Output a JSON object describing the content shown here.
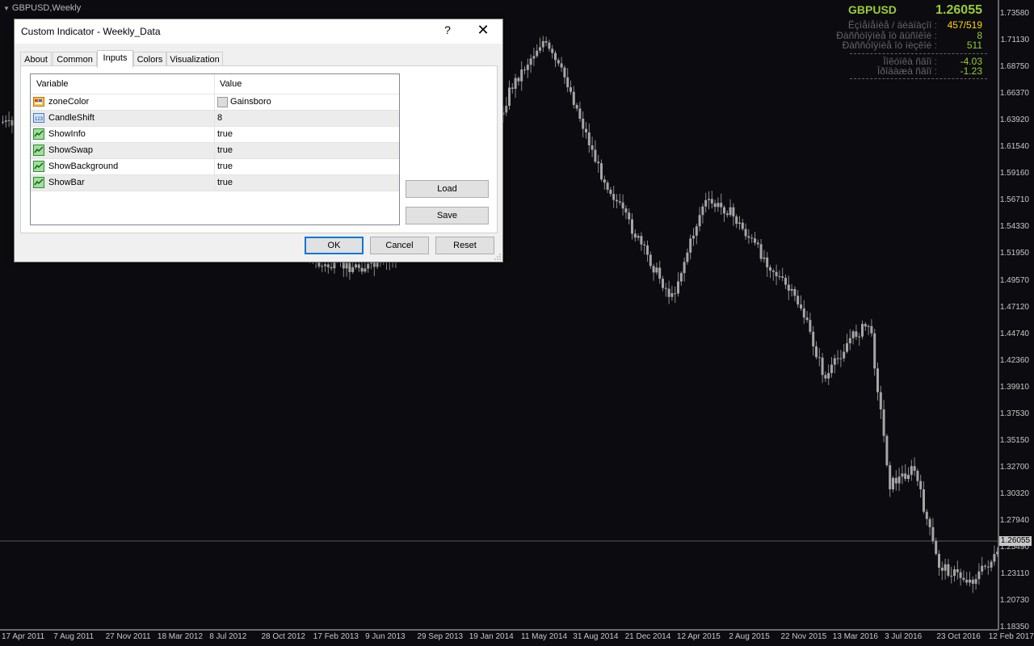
{
  "chart": {
    "title": "GBPUSD,Weekly",
    "symbol": "GBPUSD",
    "current_price": "1.26055",
    "price_tag": "1.26055",
    "info_rows": [
      {
        "label": "Ëçìåíåíèå / äèàïàçîí :",
        "value": "457/519",
        "color": "#ffd700"
      },
      {
        "label": "Ðàññòîÿíèå îò âûñîêîé :",
        "value": "8",
        "color": "#9acd32"
      },
      {
        "label": "Ðàññòîÿíèå îò íèçêîé :",
        "value": "511",
        "color": "#9acd32"
      },
      {
        "label": "Ïîêóïêà ñâîï :",
        "value": "-4.03",
        "color": "#9acd32"
      },
      {
        "label": "Ïðîäàæà ñâîï :",
        "value": "-1.23",
        "color": "#9acd32"
      }
    ],
    "y_ticks": [
      "1.73580",
      "1.71130",
      "1.68750",
      "1.66370",
      "1.63920",
      "1.61540",
      "1.59160",
      "1.56710",
      "1.54330",
      "1.51950",
      "1.49570",
      "1.47120",
      "1.44740",
      "1.42360",
      "1.39910",
      "1.37530",
      "1.35150",
      "1.32700",
      "1.30320",
      "1.27940",
      "1.25490",
      "1.23110",
      "1.20730",
      "1.18350"
    ],
    "x_ticks": [
      "17 Apr 2011",
      "7 Aug 2011",
      "27 Nov 2011",
      "18 Mar 2012",
      "8 Jul 2012",
      "28 Oct 2012",
      "17 Feb 2013",
      "9 Jun 2013",
      "29 Sep 2013",
      "19 Jan 2014",
      "11 May 2014",
      "31 Aug 2014",
      "21 Dec 2014",
      "12 Apr 2015",
      "2 Aug 2015",
      "22 Nov 2015",
      "13 Mar 2016",
      "3 Jul 2016",
      "23 Oct 2016",
      "12 Feb 2017"
    ],
    "colors": {
      "background": "#0b0b10",
      "candle": "#a0a0a0",
      "grid_line": "#3a3a3a",
      "accent": "#9acd32"
    }
  },
  "dialog": {
    "title": "Custom Indicator - Weekly_Data",
    "help": "?",
    "close": "✕",
    "tabs": [
      "About",
      "Common",
      "Inputs",
      "Colors",
      "Visualization"
    ],
    "active_tab": "Inputs",
    "columns": {
      "variable": "Variable",
      "value": "Value"
    },
    "params": [
      {
        "name": "zoneColor",
        "value": "Gainsboro",
        "icon": "color-icon"
      },
      {
        "name": "CandleShift",
        "value": "8",
        "icon": "integer-icon"
      },
      {
        "name": "ShowInfo",
        "value": "true",
        "icon": "boolean-icon"
      },
      {
        "name": "ShowSwap",
        "value": "true",
        "icon": "boolean-icon"
      },
      {
        "name": "ShowBackground",
        "value": "true",
        "icon": "boolean-icon"
      },
      {
        "name": "ShowBar",
        "value": "true",
        "icon": "boolean-icon"
      }
    ],
    "buttons": {
      "load": "Load",
      "save": "Save",
      "ok": "OK",
      "cancel": "Cancel",
      "reset": "Reset"
    }
  }
}
